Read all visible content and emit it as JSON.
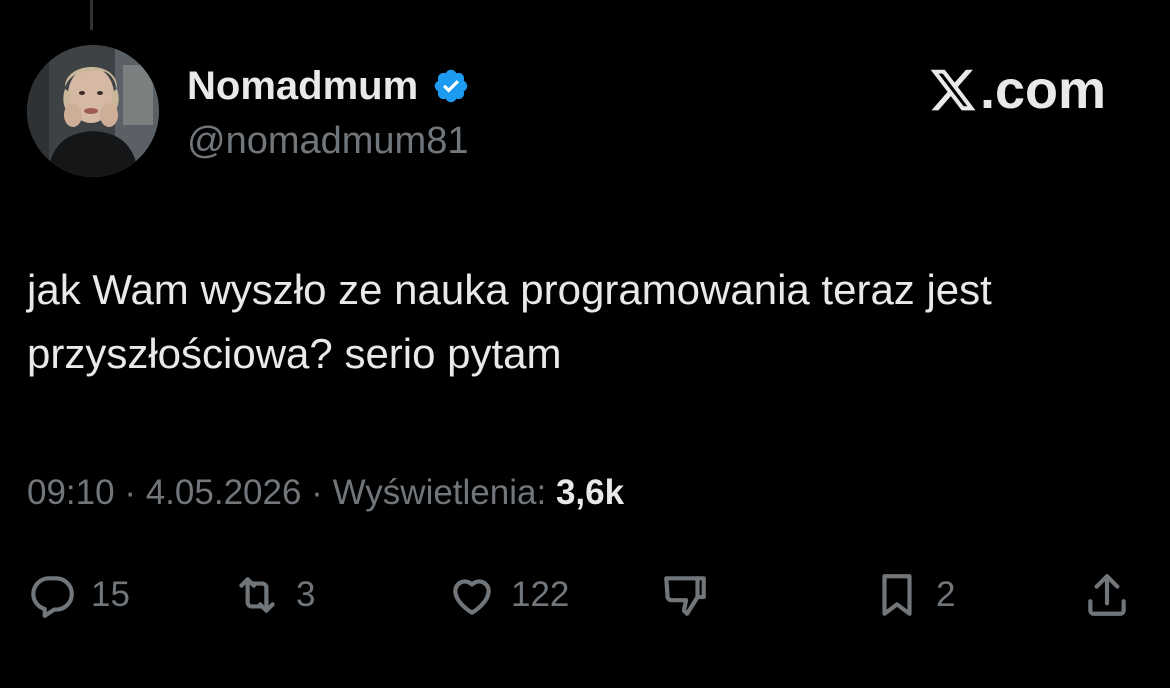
{
  "author": {
    "display_name": "Nomadmum",
    "handle": "@nomadmum81",
    "verified": true,
    "avatar_icon": "profile-photo"
  },
  "brand": {
    "suffix": ".com",
    "icon": "x-logo-icon"
  },
  "tweet": {
    "text": "jak Wam wyszło ze nauka programowania teraz jest przyszłościowa? serio pytam"
  },
  "meta": {
    "time": "09:10",
    "separator": "·",
    "date": "4.05.2026",
    "views_label": "Wyświetlenia:",
    "views_count": "3,6k"
  },
  "actions": {
    "replies": "15",
    "reposts": "3",
    "likes": "122",
    "bookmarks": "2"
  },
  "colors": {
    "background": "#000000",
    "text": "#e7e9ea",
    "secondary": "#71767b",
    "verified": "#1d9bf0"
  }
}
